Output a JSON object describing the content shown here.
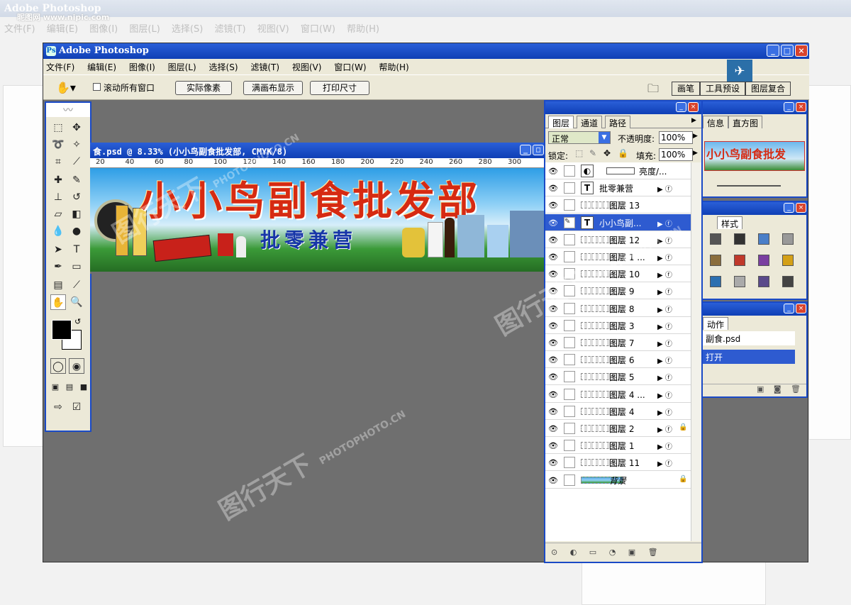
{
  "background_app": {
    "title": "Adobe Photoshop",
    "menu": [
      "文件(F)",
      "编辑(E)",
      "图像(I)",
      "图层(L)",
      "选择(S)",
      "滤镜(T)",
      "视图(V)",
      "窗口(W)",
      "帮助(H)"
    ],
    "site": "昵图网 www.nipic.com"
  },
  "window": {
    "title": "Adobe Photoshop",
    "menu": [
      "文件(F)",
      "编辑(E)",
      "图像(I)",
      "图层(L)",
      "选择(S)",
      "滤镜(T)",
      "视图(V)",
      "窗口(W)",
      "帮助(H)"
    ],
    "controls": {
      "minimize": "_",
      "maximize": "□",
      "close": "×"
    }
  },
  "options_bar": {
    "scroll_all_label": "滚动所有窗口",
    "actual_pixels": "实际像素",
    "fit_on_screen": "满画布显示",
    "print_size": "打印尺寸",
    "wells": [
      "画笔",
      "工具预设",
      "图层复合"
    ]
  },
  "document": {
    "title": "食.psd @ 8.33% (小小鸟副食批发部, CMYK/8)",
    "ruler_marks": [
      "20",
      "40",
      "60",
      "80",
      "100",
      "120",
      "140",
      "160",
      "180",
      "200",
      "220",
      "240",
      "260",
      "280",
      "300"
    ],
    "banner_title": "小小鸟副食批发部",
    "banner_subtitle": "批零兼营"
  },
  "layers_panel": {
    "tabs": [
      "图层",
      "通道",
      "路径"
    ],
    "blend_mode": "正常",
    "opacity_label": "不透明度:",
    "opacity_value": "100%",
    "lock_label": "锁定:",
    "fill_label": "填充:",
    "fill_value": "100%",
    "layers": [
      {
        "name": "亮度/...",
        "type": "adjustment",
        "fx": false,
        "lock": false,
        "selected": false
      },
      {
        "name": "批零兼营",
        "type": "text",
        "fx": true,
        "lock": false,
        "selected": false
      },
      {
        "name": "图层 13",
        "type": "pixel",
        "fx": false,
        "lock": false,
        "selected": false
      },
      {
        "name": "小小鸟副...",
        "type": "text",
        "fx": true,
        "lock": false,
        "selected": true
      },
      {
        "name": "图层 12",
        "type": "pixel",
        "fx": true,
        "lock": false,
        "selected": false
      },
      {
        "name": "图层 1 ...",
        "type": "pixel",
        "fx": true,
        "lock": false,
        "selected": false
      },
      {
        "name": "图层 10",
        "type": "pixel",
        "fx": true,
        "lock": false,
        "selected": false
      },
      {
        "name": "图层 9",
        "type": "pixel",
        "fx": true,
        "lock": false,
        "selected": false
      },
      {
        "name": "图层 8",
        "type": "pixel",
        "fx": true,
        "lock": false,
        "selected": false
      },
      {
        "name": "图层 3",
        "type": "pixel",
        "fx": true,
        "lock": false,
        "selected": false
      },
      {
        "name": "图层 7",
        "type": "pixel",
        "fx": true,
        "lock": false,
        "selected": false
      },
      {
        "name": "图层 6",
        "type": "pixel",
        "fx": true,
        "lock": false,
        "selected": false
      },
      {
        "name": "图层 5",
        "type": "pixel",
        "fx": true,
        "lock": false,
        "selected": false
      },
      {
        "name": "图层 4 ...",
        "type": "pixel",
        "fx": true,
        "lock": false,
        "selected": false
      },
      {
        "name": "图层 4",
        "type": "pixel",
        "fx": true,
        "lock": false,
        "selected": false
      },
      {
        "name": "图层 2",
        "type": "pixel",
        "fx": true,
        "lock": true,
        "selected": false
      },
      {
        "name": "图层 1",
        "type": "pixel",
        "fx": true,
        "lock": false,
        "selected": false
      },
      {
        "name": "图层 11",
        "type": "pixel",
        "fx": true,
        "lock": false,
        "selected": false
      },
      {
        "name": "背景",
        "type": "background",
        "fx": false,
        "lock": true,
        "selected": false
      }
    ]
  },
  "right_panels": {
    "navigator_tabs": [
      "信息",
      "直方图"
    ],
    "navigator_preview_text": "小小鸟副食批发",
    "styles_tab": "样式",
    "history_tab": "动作",
    "history_items": [
      "副食.psd",
      "打开"
    ]
  },
  "colors": {
    "title_blue": "#1a4ac6",
    "workspace_gray": "#6f6f6f",
    "chrome": "#ece9d8",
    "banner_red": "#d62a12",
    "banner_blue": "#1736a8",
    "selected_row": "#2e5bd0"
  },
  "watermark": {
    "brand": "图行天下",
    "site": "PHOTOPHOTO.CN"
  }
}
